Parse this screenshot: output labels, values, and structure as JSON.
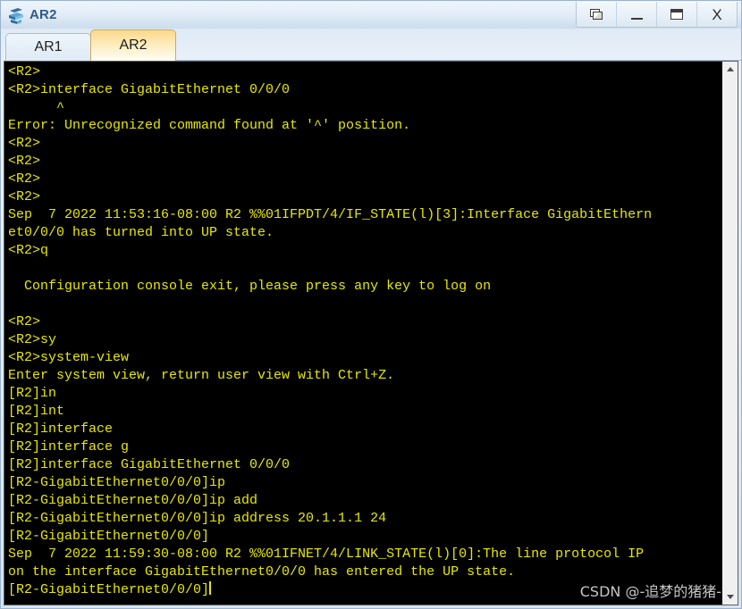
{
  "window": {
    "title": "AR2",
    "icon": "router-icon",
    "controls": [
      {
        "name": "restore-button",
        "label": "Restore"
      },
      {
        "name": "minimize-button",
        "label": "Minimize"
      },
      {
        "name": "maximize-button",
        "label": "Maximize"
      },
      {
        "name": "close-button",
        "label": "X"
      }
    ]
  },
  "tabs": [
    {
      "label": "AR1",
      "active": false
    },
    {
      "label": "AR2",
      "active": true
    }
  ],
  "terminal": {
    "foreground": "#e8e800",
    "background": "#000000",
    "lines": [
      "<R2>",
      "<R2>interface GigabitEthernet 0/0/0",
      "      ^",
      "Error: Unrecognized command found at '^' position.",
      "<R2>",
      "<R2>",
      "<R2>",
      "<R2>",
      "Sep  7 2022 11:53:16-08:00 R2 %%01IFPDT/4/IF_STATE(l)[3]:Interface GigabitEthern",
      "et0/0/0 has turned into UP state.",
      "<R2>q",
      "",
      "  Configuration console exit, please press any key to log on",
      "",
      "<R2>",
      "<R2>sy",
      "<R2>system-view",
      "Enter system view, return user view with Ctrl+Z.",
      "[R2]in",
      "[R2]int",
      "[R2]interface",
      "[R2]interface g",
      "[R2]interface GigabitEthernet 0/0/0",
      "[R2-GigabitEthernet0/0/0]ip",
      "[R2-GigabitEthernet0/0/0]ip add",
      "[R2-GigabitEthernet0/0/0]ip address 20.1.1.1 24",
      "[R2-GigabitEthernet0/0/0]",
      "Sep  7 2022 11:59:30-08:00 R2 %%01IFNET/4/LINK_STATE(l)[0]:The line protocol IP",
      "on the interface GigabitEthernet0/0/0 has entered the UP state.",
      "[R2-GigabitEthernet0/0/0]"
    ],
    "cursor_line_index": 29
  },
  "scrollbar": {
    "up_arrow": "chevron-up-icon",
    "down_arrow": "chevron-down-icon"
  },
  "watermark": {
    "text": "CSDN @-追梦的猪猪-"
  }
}
